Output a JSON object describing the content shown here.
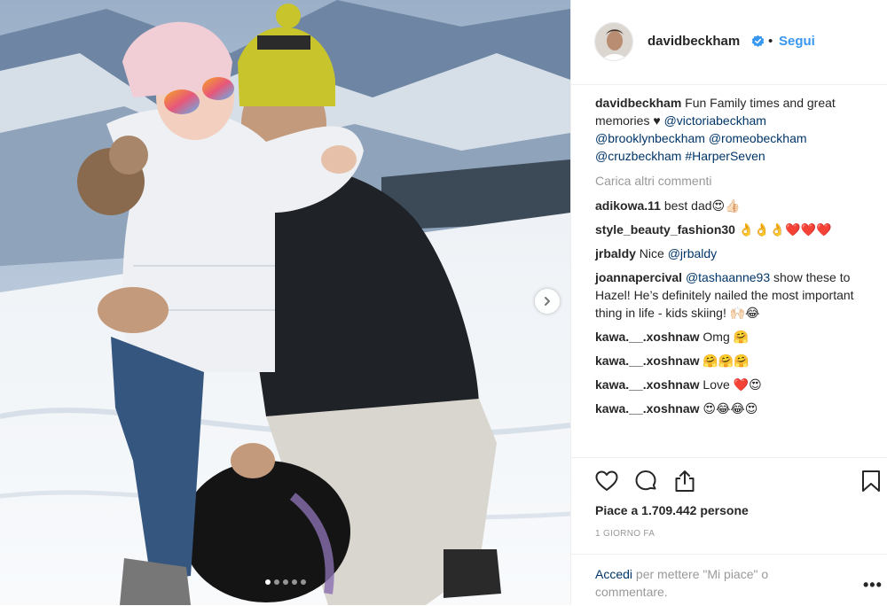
{
  "header": {
    "username": "davidbeckham",
    "separator": "•",
    "follow_label": "Segui"
  },
  "caption": {
    "username": "davidbeckham",
    "text": "Fun Family times and great memories ♥",
    "mentions": [
      "@victoriabeckham",
      "@brooklynbeckham",
      "@romeobeckham",
      "@cruzbeckham",
      "#HarperSeven"
    ]
  },
  "load_more_label": "Carica altri commenti",
  "comments": [
    {
      "user": "adikowa.11",
      "text": "best dad😍👍🏻"
    },
    {
      "user": "style_beauty_fashion30",
      "text": "👌👌👌❤️❤️❤️"
    },
    {
      "user": "jrbaldy",
      "text": "Nice",
      "mention": "@jrbaldy"
    },
    {
      "user": "joannapercival",
      "mention": "@tashaanne93",
      "text": "show these to Hazel! He’s definitely nailed the most important thing in life - kids skiing! 🙌🏻😂"
    },
    {
      "user": "kawa.__.xoshnaw",
      "text": "Omg 🤗"
    },
    {
      "user": "kawa.__.xoshnaw",
      "text": "🤗🤗🤗"
    },
    {
      "user": "kawa.__.xoshnaw",
      "text": "Love ❤️😍"
    },
    {
      "user": "kawa.__.xoshnaw",
      "text": "😍😂😂😍"
    }
  ],
  "actions": {
    "icons": [
      "heart-icon",
      "comment-icon",
      "share-icon",
      "bookmark-icon"
    ]
  },
  "likes_text": "Piace a 1.709.442 persone",
  "time_text": "1 GIORNO FA",
  "footer": {
    "login_link": "Accedi",
    "login_rest": "per mettere \"Mi piace\" o commentare.",
    "more_label": "•••"
  },
  "carousel": {
    "total": 5,
    "current": 1
  },
  "colors": {
    "link": "#003569",
    "follow": "#3897f0",
    "muted": "#999999",
    "verified": "#3897f0"
  }
}
